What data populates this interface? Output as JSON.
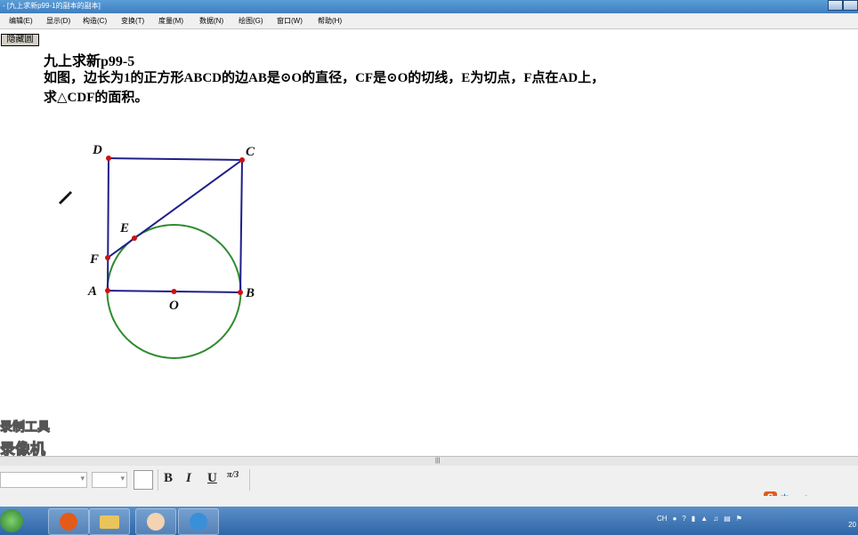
{
  "window": {
    "title": "- [九上求新p99-1的副本的副本]"
  },
  "menubar": {
    "items": [
      "编辑(E)",
      "显示(D)",
      "构造(C)",
      "变换(T)",
      "度量(M)",
      "数据(N)",
      "绘图(G)",
      "窗口(W)",
      "帮助(H)"
    ]
  },
  "canvas": {
    "hide_circle_button": "隐藏圆",
    "problem_title": "九上求新p99-5",
    "problem_line1": "如图，边长为1的正方形ABCD的边AB是⊙O的直径，CF是⊙O的切线，E为切点，F点在AD上，",
    "problem_line2": "求△CDF的面积。"
  },
  "figure": {
    "labels": {
      "D": "D",
      "C": "C",
      "E": "E",
      "F": "F",
      "A": "A",
      "O": "O",
      "B": "B"
    },
    "colors": {
      "segment": "#1f1f8a",
      "circle": "#2e8b2e",
      "point": "#cc1111"
    }
  },
  "watermark": {
    "line1": "录制工具",
    "line2": "录像机"
  },
  "text_toolbar": {
    "bold": "B",
    "italic": "I",
    "underline": "U",
    "math": "π/3"
  },
  "ime": {
    "lang": "中",
    "punct": "•,",
    "emoji": "☺"
  },
  "taskbar": {
    "tray_lang": "CH",
    "clock": "20"
  }
}
